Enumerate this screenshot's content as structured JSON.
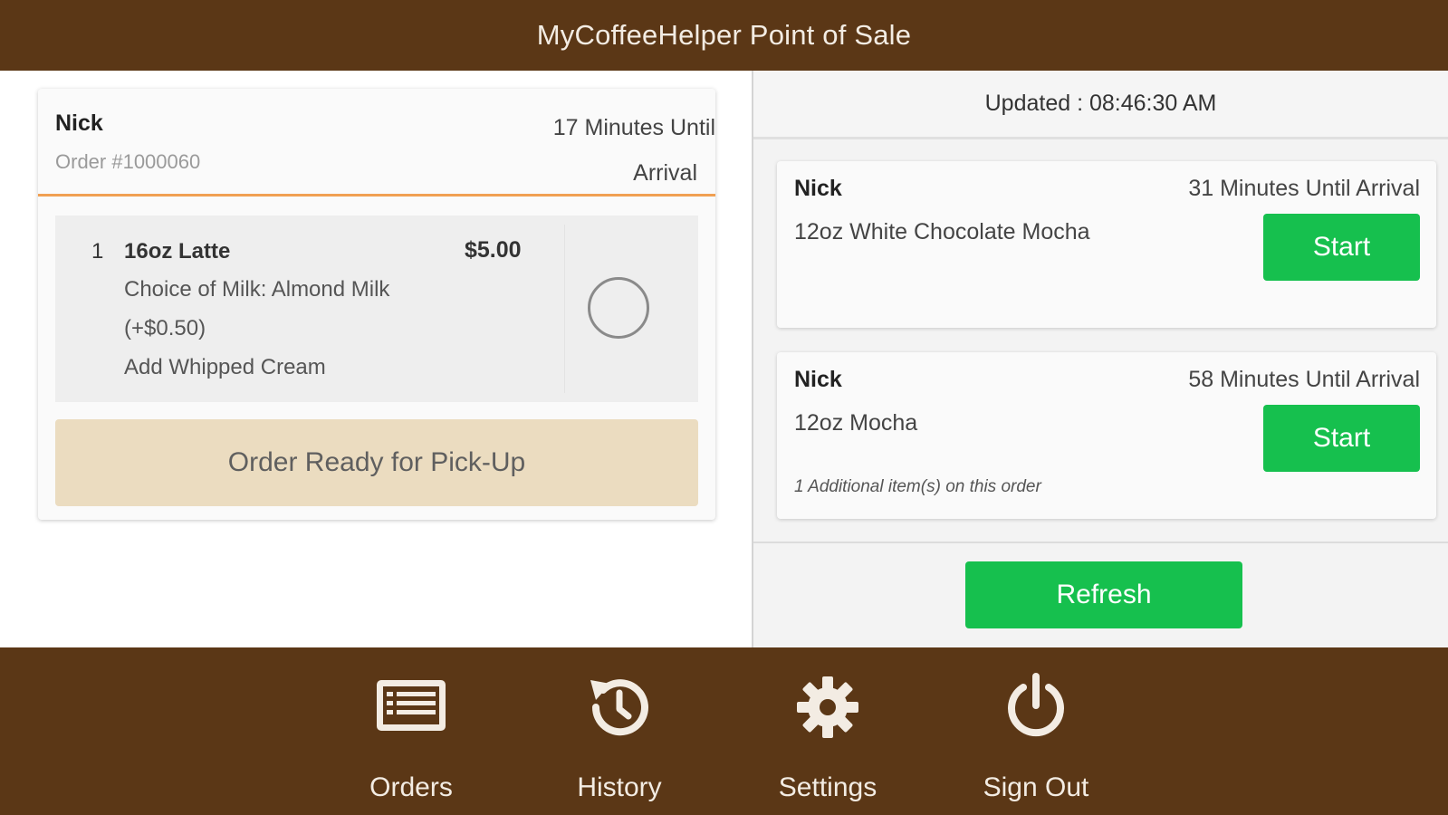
{
  "header": {
    "title": "MyCoffeeHelper Point of Sale"
  },
  "active_order": {
    "customer": "Nick",
    "order_number": "Order #1000060",
    "arrival_line1": "17 Minutes Until",
    "arrival_line2": "Arrival",
    "item": {
      "qty": "1",
      "name": "16oz Latte",
      "price": "$5.00",
      "modifiers": [
        "Choice of Milk: Almond Milk",
        "(+$0.50)",
        "Add Whipped Cream"
      ]
    },
    "ready_label": "Order Ready for Pick-Up"
  },
  "queue": {
    "updated": "Updated : 08:46:30 AM",
    "orders": [
      {
        "customer": "Nick",
        "arrival": "31 Minutes Until Arrival",
        "item": "12oz White Chocolate Mocha",
        "note": "",
        "start_label": "Start"
      },
      {
        "customer": "Nick",
        "arrival": "58 Minutes Until Arrival",
        "item": "12oz Mocha",
        "note": "1 Additional item(s) on this order",
        "start_label": "Start"
      }
    ],
    "refresh_label": "Refresh"
  },
  "nav": {
    "items": [
      {
        "label": "Orders",
        "icon": "orders-list-icon"
      },
      {
        "label": "History",
        "icon": "history-icon"
      },
      {
        "label": "Settings",
        "icon": "gear-icon"
      },
      {
        "label": "Sign Out",
        "icon": "power-icon"
      }
    ]
  },
  "colors": {
    "brand_brown": "#5b3716",
    "accent_orange": "#f0a052",
    "action_green": "#16c04e",
    "ready_beige": "#ebdcc0"
  }
}
